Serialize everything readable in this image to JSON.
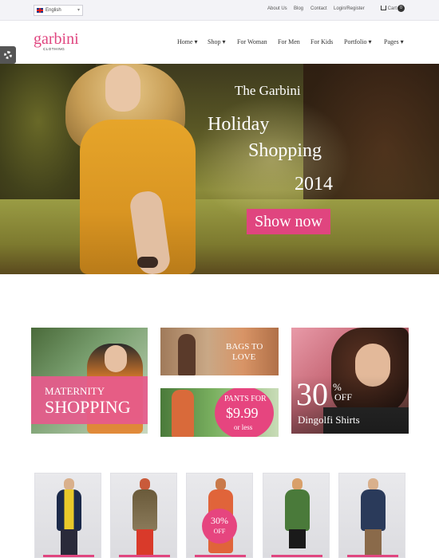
{
  "topbar": {
    "language": "English",
    "links": [
      "About Us",
      "Blog",
      "Contact",
      "Login/Register"
    ],
    "cart_label": "Cart",
    "cart_count": "0"
  },
  "header": {
    "logo": "garbini",
    "logo_sub": "CLOTHING",
    "nav": [
      "Home ▾",
      "Shop ▾",
      "For Woman",
      "For Men",
      "For Kids",
      "Portfolio ▾",
      "Pages ▾"
    ]
  },
  "hero": {
    "line1": "The Garbini",
    "line2": "Holiday",
    "line3": "Shopping",
    "line4": "2014",
    "button": "Show now"
  },
  "promos": {
    "maternity": {
      "line1": "MATERNITY",
      "line2": "SHOPPING"
    },
    "bags": {
      "line1": "BAGS TO",
      "line2": "LOVE"
    },
    "pants": {
      "line1": "PANTS FOR",
      "price": "$9.99",
      "line3": "or less"
    },
    "shirts": {
      "big": "30",
      "pct": "%",
      "off": "OFF",
      "label": "Dingolfi Shirts"
    }
  },
  "products": {
    "sale_badge": {
      "line1": "30%",
      "line2": "OFF"
    }
  },
  "colors": {
    "accent": "#e0457f"
  },
  "icons": [
    "settings-gear-icon",
    "cart-icon",
    "flag-uk-icon"
  ]
}
